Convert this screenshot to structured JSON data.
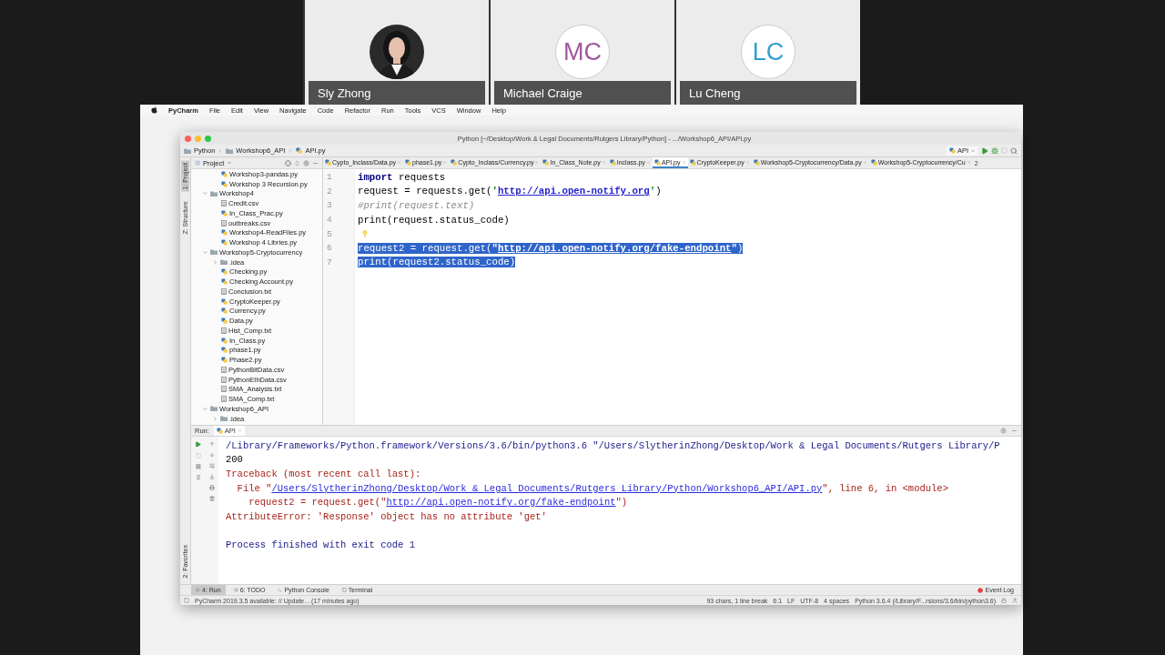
{
  "meeting": {
    "participants": [
      {
        "name": "Sly Zhong"
      },
      {
        "kind": "initials",
        "name": "Michael Craige",
        "initials": "MC",
        "color": "#a0569e"
      },
      {
        "kind": "initials",
        "name": "Lu Cheng",
        "initials": "LC",
        "color": "#2e9fd3"
      }
    ]
  },
  "menu_bar": {
    "app": "PyCharm",
    "items": [
      "File",
      "Edit",
      "View",
      "Navigate",
      "Code",
      "Refactor",
      "Run",
      "Tools",
      "VCS",
      "Window",
      "Help"
    ]
  },
  "window": {
    "title": "Python [~/Desktop/Work & Legal Documents/Rutgers Library/Python] - .../Workshop6_API/API.py"
  },
  "breadcrumb": [
    "Python",
    "Workshop6_API",
    "API.py"
  ],
  "toolbar": {
    "run_config": "API"
  },
  "tool_strip": {
    "top": [
      {
        "label": "1: Project",
        "selected": true
      },
      {
        "label": "Z: Structure",
        "selected": false
      }
    ],
    "bottom": [
      {
        "label": "2: Favorites",
        "selected": false
      }
    ]
  },
  "project_panel": {
    "title": "Project",
    "tree": [
      {
        "name": "Workshop3-pandas.py",
        "kind": "py"
      },
      {
        "name": "Workshop 3 Recursion.py",
        "kind": "py"
      },
      {
        "name": "Workshop4",
        "kind": "folder",
        "expanded": true,
        "children": [
          {
            "name": "Credit.csv",
            "kind": "file"
          },
          {
            "name": "In_Class_Prac.py",
            "kind": "py"
          },
          {
            "name": "outbreaks.csv",
            "kind": "file"
          },
          {
            "name": "Workshop4-ReadFiles.py",
            "kind": "py"
          },
          {
            "name": "Workshop 4 Libries.py",
            "kind": "py"
          }
        ]
      },
      {
        "name": "Workshop5-Cryptocurrency",
        "kind": "folder",
        "expanded": true,
        "children": [
          {
            "name": ".idea",
            "kind": "folder",
            "expanded": false
          },
          {
            "name": "Checking.py",
            "kind": "py"
          },
          {
            "name": "Checking Account.py",
            "kind": "py"
          },
          {
            "name": "Conclusion.txt",
            "kind": "file"
          },
          {
            "name": "CryptoKeeper.py",
            "kind": "py"
          },
          {
            "name": "Currency.py",
            "kind": "py"
          },
          {
            "name": "Data.py",
            "kind": "py"
          },
          {
            "name": "Hist_Comp.txt",
            "kind": "file"
          },
          {
            "name": "In_Class.py",
            "kind": "py"
          },
          {
            "name": "phase1.py",
            "kind": "py"
          },
          {
            "name": "Phase2.py",
            "kind": "py"
          },
          {
            "name": "PythonBitData.csv",
            "kind": "file"
          },
          {
            "name": "PythonEthData.csv",
            "kind": "file"
          },
          {
            "name": "SMA_Analysis.txt",
            "kind": "file"
          },
          {
            "name": "SMA_Comp.txt",
            "kind": "file"
          }
        ]
      },
      {
        "name": "Workshop6_API",
        "kind": "folder",
        "expanded": true,
        "children": [
          {
            "name": ".idea",
            "kind": "folder",
            "expanded": false
          }
        ]
      }
    ]
  },
  "editor_tabs": [
    {
      "label": "Cypto_Inclass/Data.py",
      "selected": false
    },
    {
      "label": "phase1.py",
      "selected": false
    },
    {
      "label": "Cypto_Inclass/Currency.py",
      "selected": false
    },
    {
      "label": "In_Class_Note.py",
      "selected": false
    },
    {
      "label": "Inclass.py",
      "selected": false
    },
    {
      "label": "API.py",
      "selected": true
    },
    {
      "label": "CryptoKeeper.py",
      "selected": false
    },
    {
      "label": "Workshop5-Cryptocurrency/Data.py",
      "selected": false
    },
    {
      "label": "Workshop5-Cryptocurrency/Cu",
      "selected": false
    }
  ],
  "tab_overflow": "2",
  "editor": {
    "lines": [
      {
        "number": "1",
        "selected": false,
        "bulb": false,
        "segments": [
          {
            "kind": "keyword",
            "text": "import"
          },
          {
            "kind": "plain",
            "text": " requests"
          }
        ]
      },
      {
        "number": "2",
        "selected": false,
        "bulb": false,
        "segments": [
          {
            "kind": "plain",
            "text": "request = requests.get("
          },
          {
            "kind": "string",
            "text": "'"
          },
          {
            "kind": "url",
            "text": "http://api.open-notify.org"
          },
          {
            "kind": "string",
            "text": "'"
          },
          {
            "kind": "plain",
            "text": ")"
          }
        ]
      },
      {
        "number": "3",
        "selected": false,
        "bulb": false,
        "segments": [
          {
            "kind": "comment",
            "text": "#print(request.text)"
          }
        ]
      },
      {
        "number": "4",
        "selected": false,
        "bulb": false,
        "segments": [
          {
            "kind": "plain",
            "text": "print(request.status_code)"
          }
        ]
      },
      {
        "number": "5",
        "selected": false,
        "bulb": true
      },
      {
        "number": "6",
        "selected": true,
        "bulb": false,
        "segments": [
          {
            "kind": "plain",
            "text": "request2 = request.get("
          },
          {
            "kind": "string",
            "text": "\""
          },
          {
            "kind": "url",
            "text": "http://api.open-notify.org/fake-endpoint"
          },
          {
            "kind": "string",
            "text": "\""
          },
          {
            "kind": "plain",
            "text": ")"
          }
        ]
      },
      {
        "number": "7",
        "selected": true,
        "bulb": false,
        "segments": [
          {
            "kind": "plain",
            "text": "print(request2.status_code)"
          }
        ]
      }
    ]
  },
  "run_panel": {
    "label": "Run:",
    "tab": "API",
    "output": [
      {
        "segments": [
          {
            "kind": "cmd",
            "text": "/Library/Frameworks/Python.framework/Versions/3.6/bin/python3.6 \"/Users/SlytherinZhong/Desktop/Work & Legal Documents/Rutgers Library/P"
          }
        ]
      },
      {
        "segments": [
          {
            "kind": "plain",
            "text": "200"
          }
        ]
      },
      {
        "segments": [
          {
            "kind": "error",
            "text": "Traceback (most recent call last):"
          }
        ]
      },
      {
        "segments": [
          {
            "kind": "error",
            "text": "  File \""
          },
          {
            "kind": "link",
            "text": "/Users/SlytherinZhong/Desktop/Work & Legal Documents/Rutgers Library/Python/Workshop6_API/API.py"
          },
          {
            "kind": "error",
            "text": "\", line 6, in <module>"
          }
        ]
      },
      {
        "segments": [
          {
            "kind": "error",
            "text": "    request2 = request.get(\""
          },
          {
            "kind": "link",
            "text": "http://api.open-notify.org/fake-endpoint"
          },
          {
            "kind": "error",
            "text": "\")"
          }
        ]
      },
      {
        "segments": [
          {
            "kind": "error",
            "text": "AttributeError: 'Response' object has no attribute 'get'"
          }
        ]
      },
      {
        "separated": true,
        "segments": [
          {
            "kind": "cmd",
            "text": "Process finished with exit code 1"
          }
        ]
      }
    ]
  },
  "bottom_tabs": [
    {
      "label": "4: Run",
      "selected": true
    },
    {
      "label": "6: TODO",
      "selected": false
    },
    {
      "label": "Python Console",
      "selected": false
    },
    {
      "label": "Terminal",
      "selected": false
    }
  ],
  "event_log": "Event Log",
  "status_bar": {
    "message": "PyCharm 2019.3.5 available: // Update... (17 minutes ago)",
    "items": [
      "93 chars, 1 line break",
      "6:1",
      "LF",
      "UTF-8",
      "4 spaces",
      "Python 3.6.4 (/Library/F...rsions/3.6/bin/python3.6)"
    ]
  }
}
